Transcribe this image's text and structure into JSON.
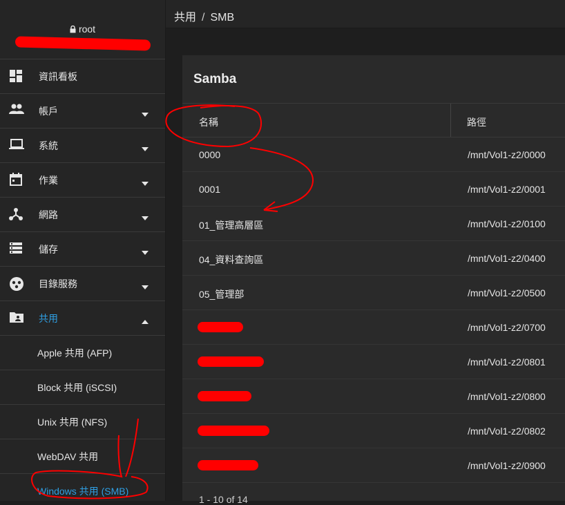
{
  "user": {
    "name": "root",
    "hostname": ""
  },
  "breadcrumb": {
    "section": "共用",
    "page": "SMB"
  },
  "nav": [
    {
      "label": "資訊看板",
      "icon": "dashboard-icon",
      "expandable": false
    },
    {
      "label": "帳戶",
      "icon": "people-icon",
      "expandable": true
    },
    {
      "label": "系統",
      "icon": "laptop-icon",
      "expandable": true
    },
    {
      "label": "作業",
      "icon": "calendar-icon",
      "expandable": true
    },
    {
      "label": "網路",
      "icon": "network-icon",
      "expandable": true
    },
    {
      "label": "儲存",
      "icon": "storage-icon",
      "expandable": true
    },
    {
      "label": "目錄服務",
      "icon": "directory-icon",
      "expandable": true
    },
    {
      "label": "共用",
      "icon": "folder-shared-icon",
      "expandable": true,
      "expanded": true
    }
  ],
  "subnav": [
    {
      "label": "Apple 共用 (AFP)"
    },
    {
      "label": "Block 共用 (iSCSI)"
    },
    {
      "label": "Unix 共用 (NFS)"
    },
    {
      "label": "WebDAV 共用"
    },
    {
      "label": "Windows 共用 (SMB)",
      "active": true
    }
  ],
  "card": {
    "title": "Samba",
    "columns": {
      "name": "名稱",
      "path": "路徑"
    },
    "rows": [
      {
        "name": "0000",
        "path": "/mnt/Vol1-z2/0000"
      },
      {
        "name": "0001",
        "path": "/mnt/Vol1-z2/0001"
      },
      {
        "name": "01_管理高層區",
        "path": "/mnt/Vol1-z2/0100"
      },
      {
        "name": "04_資料查詢區",
        "path": "/mnt/Vol1-z2/0400"
      },
      {
        "name": "05_管理部",
        "path": "/mnt/Vol1-z2/0500"
      },
      {
        "name": "",
        "path": "/mnt/Vol1-z2/0700",
        "redacted": true
      },
      {
        "name": "",
        "path": "/mnt/Vol1-z2/0801",
        "redacted": true
      },
      {
        "name": "",
        "path": "/mnt/Vol1-z2/0800",
        "redacted": true
      },
      {
        "name": "",
        "path": "/mnt/Vol1-z2/0802",
        "redacted": true
      },
      {
        "name": "",
        "path": "/mnt/Vol1-z2/0900",
        "redacted": true
      }
    ],
    "pager": "1 - 10 of 14"
  },
  "colors": {
    "accent": "#2f9fe3",
    "annotation": "#ff0000"
  }
}
